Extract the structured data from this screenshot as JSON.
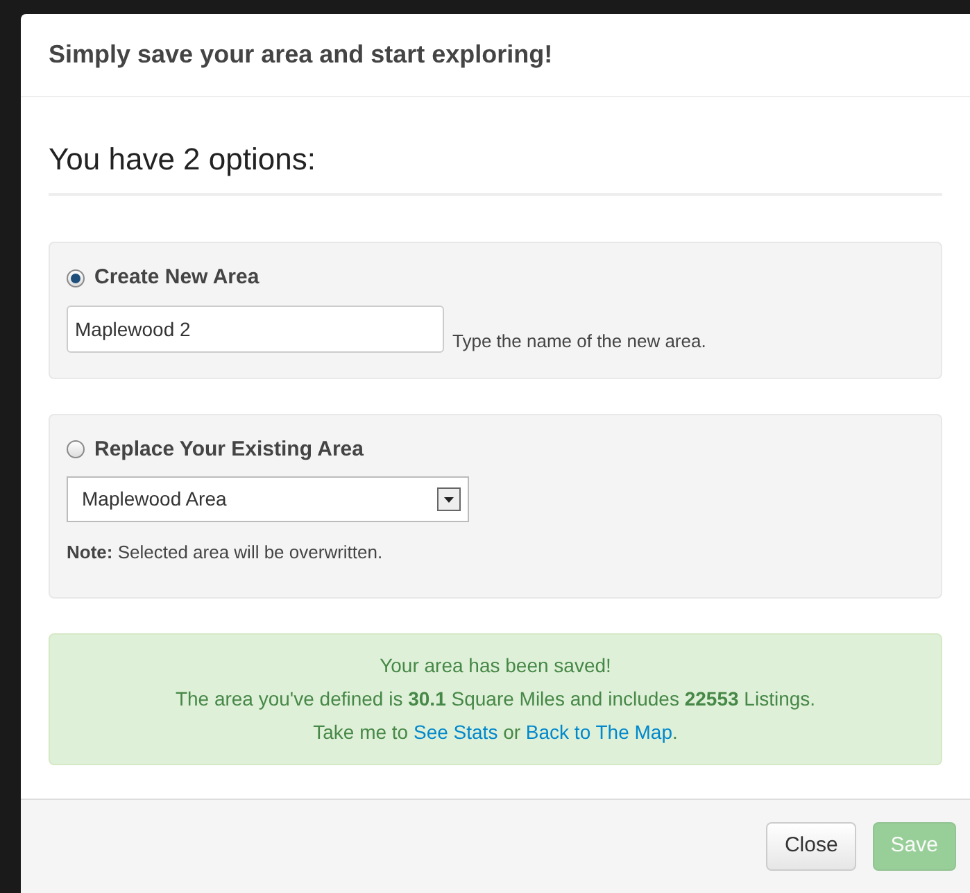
{
  "dialog": {
    "title": "Simply save your area and start exploring!"
  },
  "heading": "You have 2 options:",
  "options": [
    {
      "kind": "text",
      "label": "Create New Area",
      "selected": true,
      "value": "Maplewood 2",
      "hint": "Type the name of the new area."
    },
    {
      "kind": "select",
      "label": "Replace Your Existing Area",
      "selected": false,
      "value": "Maplewood Area",
      "note": "**Note:** Selected area will be overwritten."
    }
  ],
  "alert": {
    "lines": [
      "Your area has been saved!",
      "The area you've defined is **30.1** Square Miles and includes **22553** Listings."
    ],
    "parts": [
      {
        "kind": "text",
        "text": "Take me to "
      },
      {
        "kind": "link",
        "text": "See Stats"
      },
      {
        "kind": "text",
        "text": " or "
      },
      {
        "kind": "link",
        "text": "Back to The Map"
      },
      {
        "kind": "text",
        "text": "."
      }
    ]
  },
  "buttons": [
    {
      "label": "Close",
      "kind": "default",
      "disabled": false
    },
    {
      "label": "Save",
      "kind": "primary",
      "disabled": true
    }
  ]
}
